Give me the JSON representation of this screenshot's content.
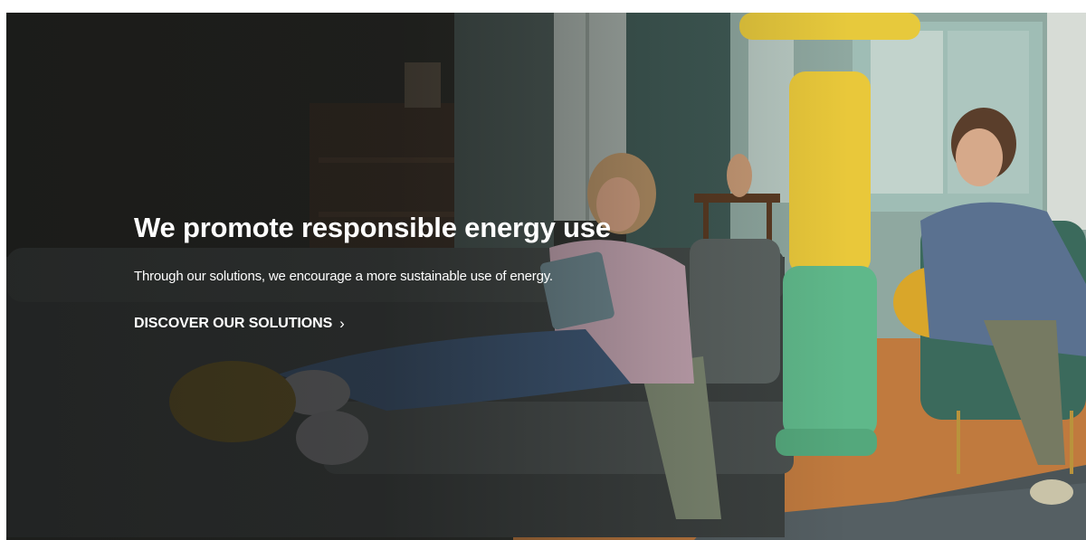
{
  "hero": {
    "headline": "We promote responsible energy use",
    "subtitle": "Through our solutions, we encourage a more sustainable use of energy.",
    "cta_label": "DISCOVER OUR SOLUTIONS",
    "cta_icon": "chevron-right-icon",
    "image_description_icon": "hero-background-image"
  },
  "colors": {
    "text": "#ffffff",
    "overlay": "#121212",
    "lamp_yellow": "#e9c83a",
    "lamp_green": "#5fb88a"
  }
}
